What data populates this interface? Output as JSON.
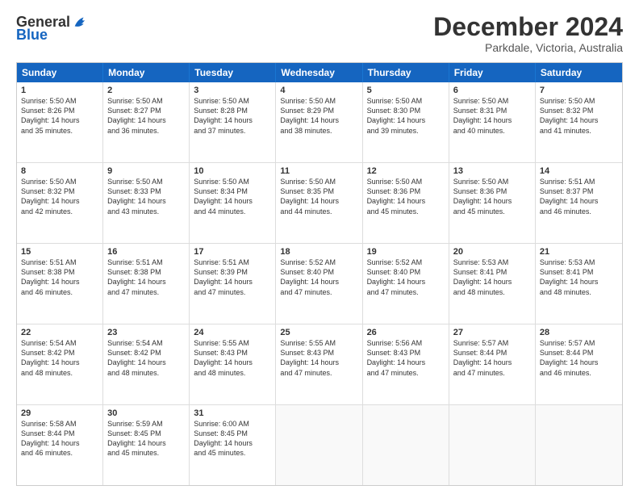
{
  "logo": {
    "text_general": "General",
    "text_blue": "Blue"
  },
  "header": {
    "month": "December 2024",
    "location": "Parkdale, Victoria, Australia"
  },
  "calendar": {
    "days": [
      "Sunday",
      "Monday",
      "Tuesday",
      "Wednesday",
      "Thursday",
      "Friday",
      "Saturday"
    ],
    "rows": [
      [
        {
          "day": "1",
          "info": "Sunrise: 5:50 AM\nSunset: 8:26 PM\nDaylight: 14 hours\nand 35 minutes."
        },
        {
          "day": "2",
          "info": "Sunrise: 5:50 AM\nSunset: 8:27 PM\nDaylight: 14 hours\nand 36 minutes."
        },
        {
          "day": "3",
          "info": "Sunrise: 5:50 AM\nSunset: 8:28 PM\nDaylight: 14 hours\nand 37 minutes."
        },
        {
          "day": "4",
          "info": "Sunrise: 5:50 AM\nSunset: 8:29 PM\nDaylight: 14 hours\nand 38 minutes."
        },
        {
          "day": "5",
          "info": "Sunrise: 5:50 AM\nSunset: 8:30 PM\nDaylight: 14 hours\nand 39 minutes."
        },
        {
          "day": "6",
          "info": "Sunrise: 5:50 AM\nSunset: 8:31 PM\nDaylight: 14 hours\nand 40 minutes."
        },
        {
          "day": "7",
          "info": "Sunrise: 5:50 AM\nSunset: 8:32 PM\nDaylight: 14 hours\nand 41 minutes."
        }
      ],
      [
        {
          "day": "8",
          "info": "Sunrise: 5:50 AM\nSunset: 8:32 PM\nDaylight: 14 hours\nand 42 minutes."
        },
        {
          "day": "9",
          "info": "Sunrise: 5:50 AM\nSunset: 8:33 PM\nDaylight: 14 hours\nand 43 minutes."
        },
        {
          "day": "10",
          "info": "Sunrise: 5:50 AM\nSunset: 8:34 PM\nDaylight: 14 hours\nand 44 minutes."
        },
        {
          "day": "11",
          "info": "Sunrise: 5:50 AM\nSunset: 8:35 PM\nDaylight: 14 hours\nand 44 minutes."
        },
        {
          "day": "12",
          "info": "Sunrise: 5:50 AM\nSunset: 8:36 PM\nDaylight: 14 hours\nand 45 minutes."
        },
        {
          "day": "13",
          "info": "Sunrise: 5:50 AM\nSunset: 8:36 PM\nDaylight: 14 hours\nand 45 minutes."
        },
        {
          "day": "14",
          "info": "Sunrise: 5:51 AM\nSunset: 8:37 PM\nDaylight: 14 hours\nand 46 minutes."
        }
      ],
      [
        {
          "day": "15",
          "info": "Sunrise: 5:51 AM\nSunset: 8:38 PM\nDaylight: 14 hours\nand 46 minutes."
        },
        {
          "day": "16",
          "info": "Sunrise: 5:51 AM\nSunset: 8:38 PM\nDaylight: 14 hours\nand 47 minutes."
        },
        {
          "day": "17",
          "info": "Sunrise: 5:51 AM\nSunset: 8:39 PM\nDaylight: 14 hours\nand 47 minutes."
        },
        {
          "day": "18",
          "info": "Sunrise: 5:52 AM\nSunset: 8:40 PM\nDaylight: 14 hours\nand 47 minutes."
        },
        {
          "day": "19",
          "info": "Sunrise: 5:52 AM\nSunset: 8:40 PM\nDaylight: 14 hours\nand 47 minutes."
        },
        {
          "day": "20",
          "info": "Sunrise: 5:53 AM\nSunset: 8:41 PM\nDaylight: 14 hours\nand 48 minutes."
        },
        {
          "day": "21",
          "info": "Sunrise: 5:53 AM\nSunset: 8:41 PM\nDaylight: 14 hours\nand 48 minutes."
        }
      ],
      [
        {
          "day": "22",
          "info": "Sunrise: 5:54 AM\nSunset: 8:42 PM\nDaylight: 14 hours\nand 48 minutes."
        },
        {
          "day": "23",
          "info": "Sunrise: 5:54 AM\nSunset: 8:42 PM\nDaylight: 14 hours\nand 48 minutes."
        },
        {
          "day": "24",
          "info": "Sunrise: 5:55 AM\nSunset: 8:43 PM\nDaylight: 14 hours\nand 48 minutes."
        },
        {
          "day": "25",
          "info": "Sunrise: 5:55 AM\nSunset: 8:43 PM\nDaylight: 14 hours\nand 47 minutes."
        },
        {
          "day": "26",
          "info": "Sunrise: 5:56 AM\nSunset: 8:43 PM\nDaylight: 14 hours\nand 47 minutes."
        },
        {
          "day": "27",
          "info": "Sunrise: 5:57 AM\nSunset: 8:44 PM\nDaylight: 14 hours\nand 47 minutes."
        },
        {
          "day": "28",
          "info": "Sunrise: 5:57 AM\nSunset: 8:44 PM\nDaylight: 14 hours\nand 46 minutes."
        }
      ],
      [
        {
          "day": "29",
          "info": "Sunrise: 5:58 AM\nSunset: 8:44 PM\nDaylight: 14 hours\nand 46 minutes."
        },
        {
          "day": "30",
          "info": "Sunrise: 5:59 AM\nSunset: 8:45 PM\nDaylight: 14 hours\nand 45 minutes."
        },
        {
          "day": "31",
          "info": "Sunrise: 6:00 AM\nSunset: 8:45 PM\nDaylight: 14 hours\nand 45 minutes."
        },
        {
          "day": "",
          "info": ""
        },
        {
          "day": "",
          "info": ""
        },
        {
          "day": "",
          "info": ""
        },
        {
          "day": "",
          "info": ""
        }
      ]
    ]
  }
}
